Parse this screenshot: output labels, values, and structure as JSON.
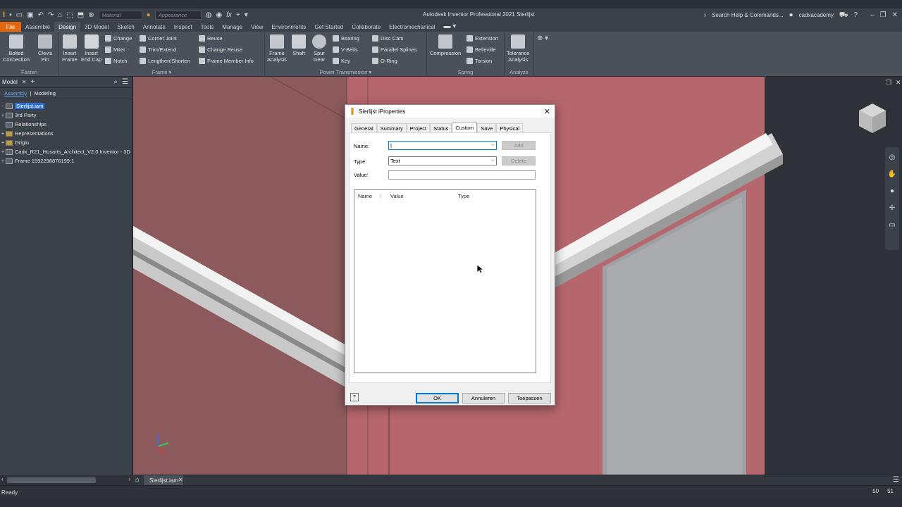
{
  "app": {
    "title": "Autodesk Inventor Professional 2021   Sierlijst",
    "material_placeholder": "Material",
    "appearance_placeholder": "Appearance",
    "search_help": "Search Help & Commands...",
    "user": "cadxacademy"
  },
  "ribbon": {
    "tabs": [
      "File",
      "Assemble",
      "Design",
      "3D Model",
      "Sketch",
      "Annotate",
      "Inspect",
      "Tools",
      "Manage",
      "View",
      "Environments",
      "Get Started",
      "Collaborate",
      "Electromechanical"
    ],
    "active_tab": "Design",
    "fasten": {
      "title": "Fasten",
      "bolted": "Bolted\nConnection",
      "clevis": "Clevis\nPin"
    },
    "frame": {
      "title": "Frame",
      "insert_frame": "Insert\nFrame",
      "insert_end_cap": "Insert\nEnd Cap",
      "change": "Change",
      "miter": "Miter",
      "notch": "Notch",
      "corner_joint": "Corner Joint",
      "trim_extend": "Trim/Extend",
      "lengthen_shorten": "Lengthen/Shorten",
      "reuse": "Reuse",
      "change_reuse": "Change Reuse",
      "frame_member_info": "Frame Member Info"
    },
    "power_transmission": {
      "title": "Power Transmission",
      "frame_analysis": "Frame\nAnalysis",
      "shaft": "Shaft",
      "spur_gear": "Spur\nGear",
      "bearing": "Bearing",
      "vbelts": "V-Belts",
      "key": "Key",
      "disc_cam": "Disc Cam",
      "parallel_splines": "Parallel Splines",
      "oring": "O-Ring"
    },
    "spring": {
      "title": "Spring",
      "compression": "Compression",
      "extension": "Extension",
      "belleville": "Belleville",
      "torsion": "Torsion"
    },
    "analyze": {
      "title": "Analyze",
      "tolerance": "Tolerance\nAnalysis"
    }
  },
  "browser": {
    "tab": "Model",
    "sub_assembly": "Assembly",
    "sub_modeling": "Modeling",
    "items": [
      {
        "label": "Sierlijst.iam",
        "expander": "-",
        "selected": true,
        "icon": "assembly-icon"
      },
      {
        "label": "3rd Party",
        "expander": "+",
        "icon": "third-party-icon"
      },
      {
        "label": "Relationships",
        "expander": "",
        "icon": "relationships-icon"
      },
      {
        "label": "Representations",
        "expander": "+",
        "icon": "folder-icon"
      },
      {
        "label": "Origin",
        "expander": "+",
        "icon": "folder-icon"
      },
      {
        "label": "Cadx_R21_Husarts_Architect_V2.0 Inventor - 3D",
        "expander": "+",
        "icon": "part-icon"
      },
      {
        "label": "Frame 1592298876199:1",
        "expander": "+",
        "icon": "frame-icon"
      }
    ]
  },
  "document": {
    "tab_label": "Sierlijst.iam"
  },
  "status": {
    "text": "Ready",
    "count1": "50",
    "count2": "51"
  },
  "dialog": {
    "title": "Sierlijst iProperties",
    "tabs": [
      "General",
      "Summary",
      "Project",
      "Status",
      "Custom",
      "Save",
      "Physical"
    ],
    "active_tab": "Custom",
    "name_label": "Name:",
    "name_value": "",
    "type_label": "Type:",
    "type_value": "Text",
    "value_label": "Value:",
    "value_value": "",
    "add_label": "Add",
    "delete_label": "Delete",
    "columns": [
      "Name",
      "/",
      "Value",
      "Type"
    ],
    "ok_label": "OK",
    "cancel_label": "Annuleren",
    "apply_label": "Toepassen"
  }
}
